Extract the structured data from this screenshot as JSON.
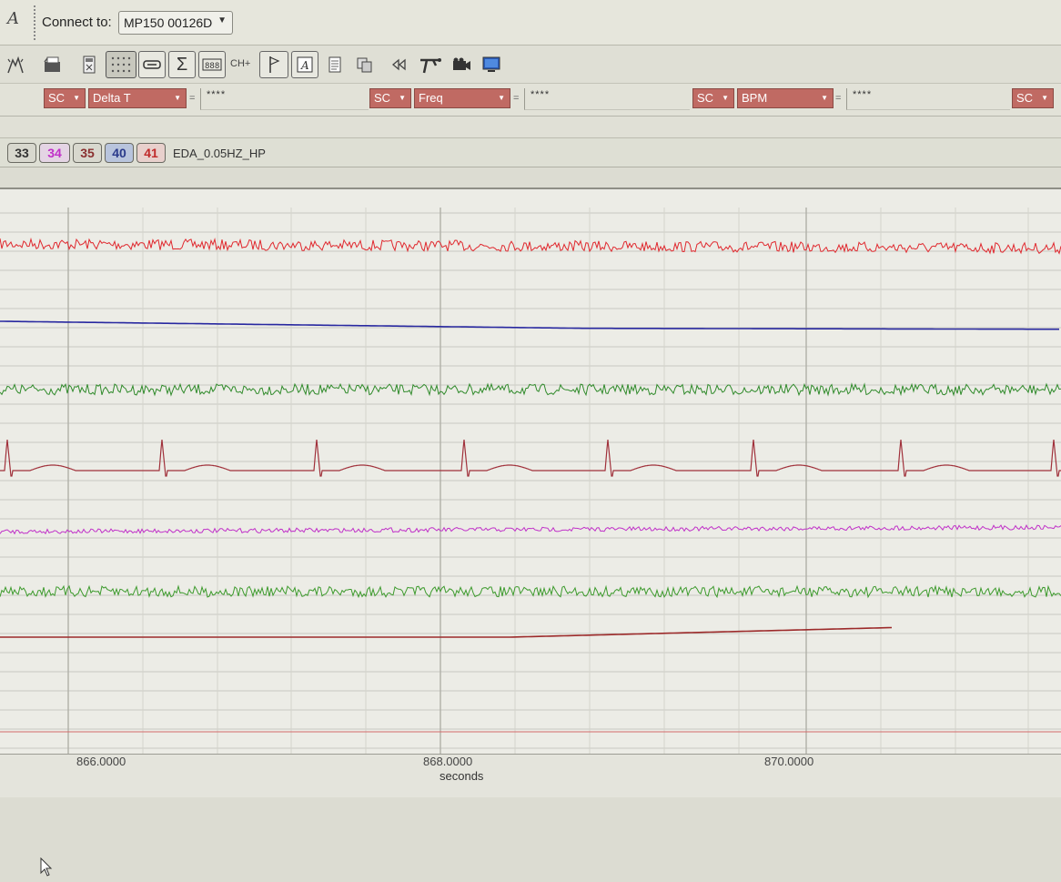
{
  "connect": {
    "app_glyph": "A",
    "label": "Connect to:",
    "device": "MP150 00126D"
  },
  "toolbar": {
    "ch_label": "CH+"
  },
  "measurements": [
    {
      "source": "SC",
      "function": "Delta T",
      "result": "****"
    },
    {
      "source": "SC",
      "function": "Freq",
      "result": "****"
    },
    {
      "source": "SC",
      "function": "BPM",
      "result": "****"
    },
    {
      "source": "SC"
    }
  ],
  "channels": {
    "buttons": [
      "33",
      "34",
      "35",
      "40",
      "41"
    ],
    "active_name": "EDA_0.05HZ_HP"
  },
  "axis": {
    "ticks": [
      "866.0000",
      "868.0000",
      "870.0000"
    ],
    "unit": "seconds"
  },
  "colors": {
    "trace_red": "#e0282e",
    "trace_blue": "#2828a0",
    "trace_green": "#2f8a2a",
    "trace_ecg": "#a0303a",
    "trace_magenta": "#c030c8",
    "trace_green2": "#3c9a2c",
    "trace_darkred": "#9c2a2a",
    "measurement_bg": "#c06a63"
  },
  "icons": [
    "wand-icon",
    "open-folder-icon",
    "calculator-icon",
    "grid-icon",
    "minus-box-icon",
    "sigma-icon",
    "digits-icon",
    "flag-icon",
    "text-marker-icon",
    "journal-icon",
    "copy-icon",
    "rewind-icon",
    "antenna-icon",
    "camera-icon",
    "monitor-icon",
    "cursor-arrow-icon"
  ]
}
